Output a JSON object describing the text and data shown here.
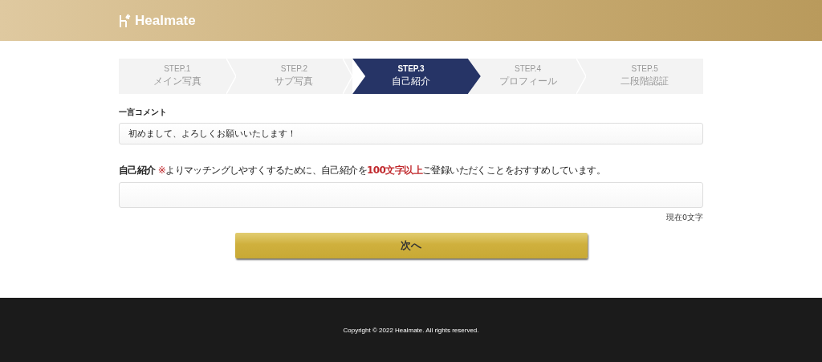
{
  "header": {
    "logo": "Healmate"
  },
  "steps": [
    {
      "label": "STEP.1",
      "title": "メイン写真",
      "selected": false
    },
    {
      "label": "STEP.2",
      "title": "サブ写真",
      "selected": false
    },
    {
      "label": "STEP.3",
      "title": "自己紹介",
      "selected": true
    },
    {
      "label": "STEP.4",
      "title": "プロフィール",
      "selected": false
    },
    {
      "label": "STEP.5",
      "title": "二段階認証",
      "selected": false
    }
  ],
  "comment": {
    "label": "一言コメント",
    "value": "初めまして、よろしくお願いいたします！"
  },
  "intro": {
    "label": "自己紹介",
    "note_mark": "※",
    "note_before": "よりマッチングしやすくするために、自己紹介を",
    "note_emphasis": "100文字以上",
    "note_after": "ご登録いただくことをおすすめしています。",
    "counter": "現在0文字"
  },
  "next_button": "次へ",
  "footer": {
    "copyright": "Copyright © 2022 Healmate. All rights reserved."
  }
}
